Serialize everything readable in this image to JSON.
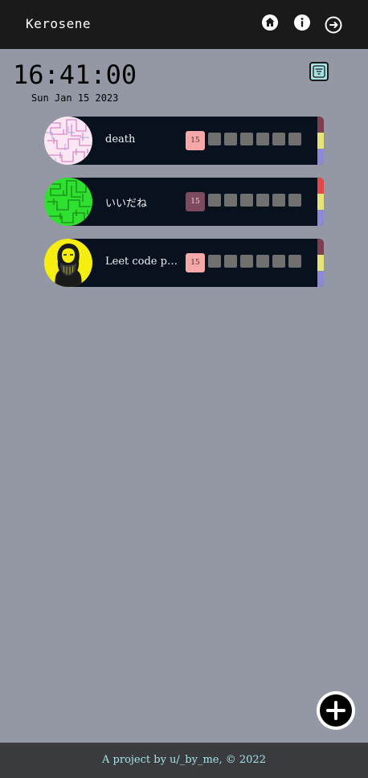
{
  "header": {
    "app_title": "Kerosene",
    "nav": [
      {
        "icon": "home-icon"
      },
      {
        "icon": "info-icon"
      },
      {
        "icon": "logout-icon"
      }
    ]
  },
  "clock": {
    "time": "16:41:00",
    "date": "Sun Jan 15 2023"
  },
  "filter_button": {
    "icon": "filter-icon"
  },
  "habits": [
    {
      "title": "death",
      "avatar": "pink-maze-pattern",
      "day": "15",
      "day_badge_bg": "#f4a9a8",
      "day_badge_color": "#4a2a2a",
      "stripes": [
        "#7e3f53",
        "#e6e478",
        "#8c8ad4"
      ]
    },
    {
      "title": "いいだね",
      "avatar": "green-maze-pattern",
      "day": "15",
      "day_badge_bg": "#7e4a5e",
      "day_badge_color": "#f0d0d8",
      "stripes": [
        "#e54848",
        "#e6e478",
        "#8c8ad4"
      ]
    },
    {
      "title": "Leet code practice",
      "avatar": "bearded-man-portrait",
      "day": "15",
      "day_badge_bg": "#f4a9a8",
      "day_badge_color": "#4a2a2a",
      "stripes": [
        "#7e3f53",
        "#e6e478",
        "#8c8ad4"
      ]
    }
  ],
  "fab": {
    "icon": "plus-icon"
  },
  "footer": {
    "text": "A project by u/_by_me, © 2022"
  },
  "colors": {
    "background": "#9498a4",
    "topbar": "#1a1a1a",
    "card": "#08111e",
    "accent": "#a7e3e6",
    "footer": "#3a3b3f",
    "empty_day": "#707070"
  }
}
